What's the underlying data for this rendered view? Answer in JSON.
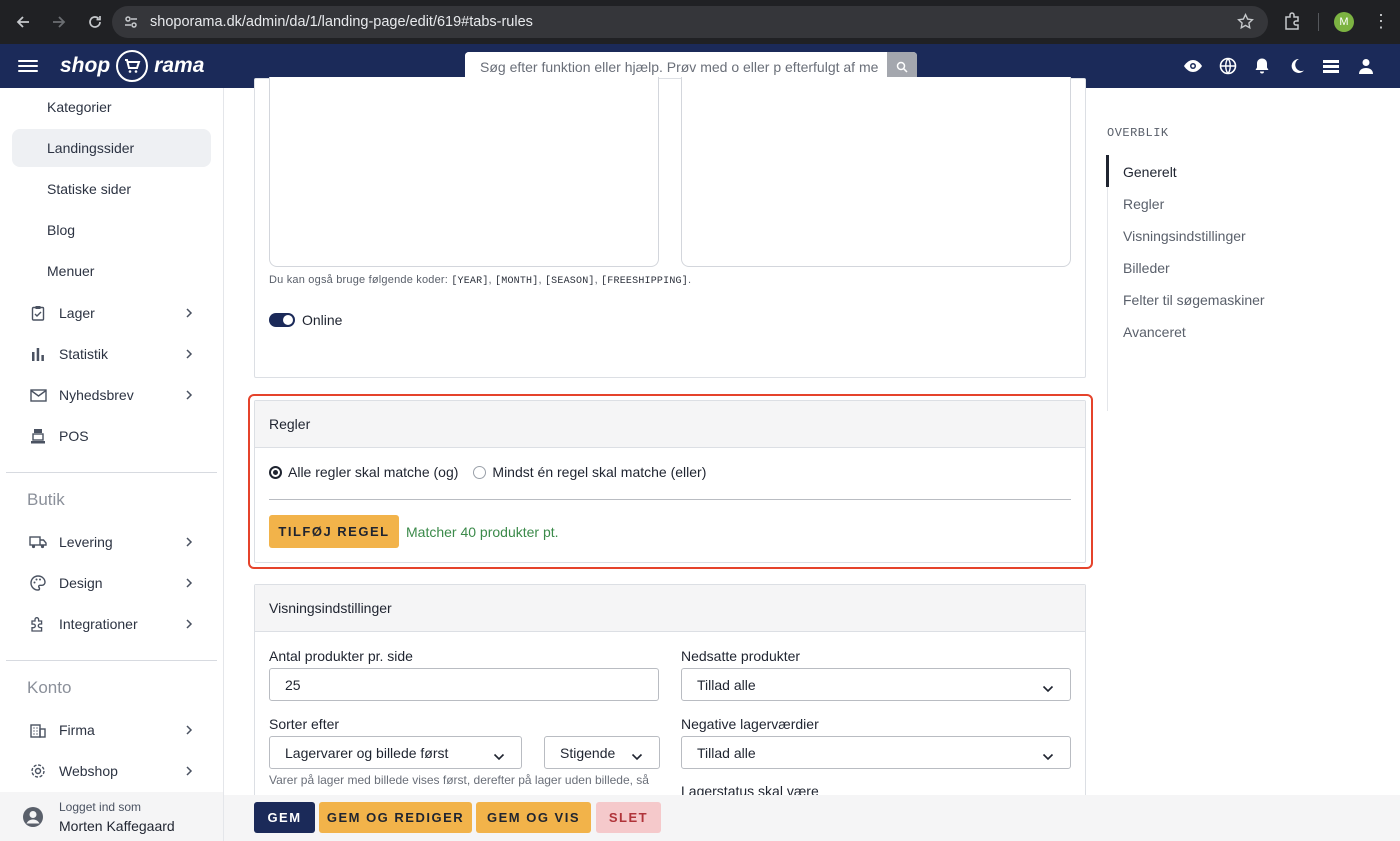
{
  "browser": {
    "url": "shoporama.dk/admin/da/1/landing-page/edit/619#tabs-rules",
    "profile_initial": "M"
  },
  "header": {
    "logo_left": "shop",
    "logo_right": "rama",
    "search_placeholder": "Søg efter funktion eller hjælp. Prøv med o eller p efterfulgt af me",
    "icons": [
      "eye-icon",
      "globe-icon",
      "bell-icon",
      "moon-icon",
      "stack-icon",
      "user-icon"
    ]
  },
  "sidebar": {
    "subitems": [
      {
        "label": "Kategorier",
        "active": false
      },
      {
        "label": "Landingssider",
        "active": true
      },
      {
        "label": "Statiske sider",
        "active": false
      },
      {
        "label": "Blog",
        "active": false
      },
      {
        "label": "Menuer",
        "active": false
      }
    ],
    "items": [
      {
        "label": "Lager",
        "icon": "clipboard-icon"
      },
      {
        "label": "Statistik",
        "icon": "bar-chart-icon"
      },
      {
        "label": "Nyhedsbrev",
        "icon": "mail-icon"
      },
      {
        "label": "POS",
        "icon": "register-icon"
      }
    ],
    "section_butik": "Butik",
    "butik_items": [
      {
        "label": "Levering",
        "icon": "truck-icon"
      },
      {
        "label": "Design",
        "icon": "palette-icon"
      },
      {
        "label": "Integrationer",
        "icon": "puzzle-icon"
      }
    ],
    "section_konto": "Konto",
    "konto_items": [
      {
        "label": "Firma",
        "icon": "building-icon"
      },
      {
        "label": "Webshop",
        "icon": "settings-icon"
      }
    ],
    "footer": {
      "logged_in_label": "Logget ind som",
      "user_name": "Morten Kaffegaard"
    }
  },
  "general_card": {
    "hint_prefix": "Du kan også bruge følgende koder:",
    "codes": [
      "[YEAR]",
      "[MONTH]",
      "[SEASON]",
      "[FREESHIPPING]"
    ],
    "online_label": "Online",
    "online": true
  },
  "rules_card": {
    "title": "Regler",
    "radio_all": "Alle regler skal matche (og)",
    "radio_any": "Mindst én regel skal matche (eller)",
    "selected": "all",
    "add_button": "TILFØJ REGEL",
    "match_text": "Matcher 40 produkter pt."
  },
  "display_card": {
    "title": "Visningsindstillinger",
    "per_page_label": "Antal produkter pr. side",
    "per_page_value": "25",
    "discounted_label": "Nedsatte produkter",
    "discounted_value": "Tillad alle",
    "sort_label": "Sorter efter",
    "sort_value": "Lagervarer og billede først",
    "sort_dir_value": "Stigende",
    "negative_label": "Negative lagerværdier",
    "negative_value": "Tillad alle",
    "sort_help": "Varer på lager med billede vises først, derefter på lager uden billede, så",
    "stock_label": "Lagerstatus skal være"
  },
  "actions": {
    "save": "GEM",
    "save_edit": "GEM OG REDIGER",
    "save_view": "GEM OG VIS",
    "delete": "SLET"
  },
  "overview": {
    "title": "OVERBLIK",
    "items": [
      "Generelt",
      "Regler",
      "Visningsindstillinger",
      "Billeder",
      "Felter til søgemaskiner",
      "Avanceret"
    ],
    "active": "Generelt"
  },
  "colors": {
    "navy": "#1b2a59",
    "accent_yellow": "#f2b34a",
    "highlight_red": "#e5432b",
    "success_green": "#3b8a4a"
  }
}
